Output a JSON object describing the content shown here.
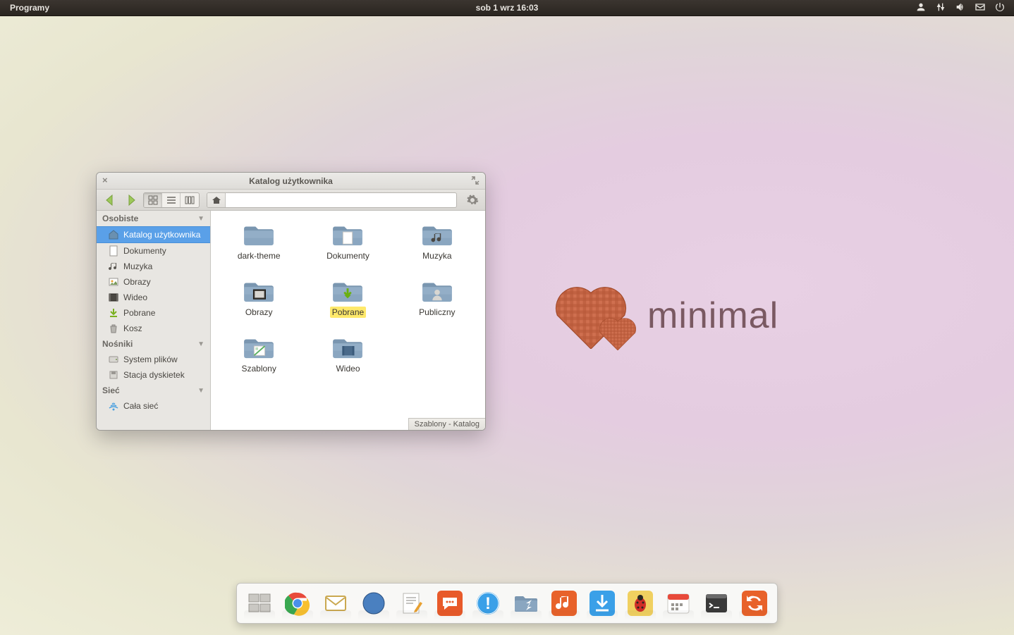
{
  "panel": {
    "menu": "Programy",
    "clock": "sob  1 wrz 16:03"
  },
  "wallpaper": {
    "brand": "minimal"
  },
  "window": {
    "title": "Katalog użytkownika",
    "statusbar": "Szablony - Katalog",
    "sidebar": {
      "sections": [
        {
          "label": "Osobiste",
          "items": [
            {
              "label": "Katalog użytkownika",
              "icon": "home",
              "selected": true
            },
            {
              "label": "Dokumenty",
              "icon": "doc"
            },
            {
              "label": "Muzyka",
              "icon": "music"
            },
            {
              "label": "Obrazy",
              "icon": "image"
            },
            {
              "label": "Wideo",
              "icon": "video"
            },
            {
              "label": "Pobrane",
              "icon": "download"
            },
            {
              "label": "Kosz",
              "icon": "trash"
            }
          ]
        },
        {
          "label": "Nośniki",
          "items": [
            {
              "label": "System plików",
              "icon": "disk"
            },
            {
              "label": "Stacja dyskietek",
              "icon": "floppy"
            }
          ]
        },
        {
          "label": "Sieć",
          "items": [
            {
              "label": "Cała sieć",
              "icon": "network"
            }
          ]
        }
      ]
    },
    "files": [
      {
        "label": "dark-theme",
        "icon": "folder"
      },
      {
        "label": "Dokumenty",
        "icon": "folder-doc"
      },
      {
        "label": "Muzyka",
        "icon": "folder-music"
      },
      {
        "label": "Obrazy",
        "icon": "folder-image"
      },
      {
        "label": "Pobrane",
        "icon": "folder-download",
        "highlight": true
      },
      {
        "label": "Publiczny",
        "icon": "folder-public"
      },
      {
        "label": "Szablony",
        "icon": "folder-template"
      },
      {
        "label": "Wideo",
        "icon": "folder-video"
      }
    ]
  },
  "dock": [
    {
      "name": "workspace-switcher",
      "bg": "#f0eeea"
    },
    {
      "name": "chrome",
      "bg": "#ffffff"
    },
    {
      "name": "mail",
      "bg": "#f9d66a"
    },
    {
      "name": "browser",
      "bg": "#ffffff"
    },
    {
      "name": "text-editor",
      "bg": "#ffffff"
    },
    {
      "name": "chat",
      "bg": "#e85a2a"
    },
    {
      "name": "help",
      "bg": "#3aa0e8"
    },
    {
      "name": "file-manager",
      "bg": "#7a96b0"
    },
    {
      "name": "music-player",
      "bg": "#e8622a"
    },
    {
      "name": "downloader",
      "bg": "#3aa0e8"
    },
    {
      "name": "bug",
      "bg": "#f0d060"
    },
    {
      "name": "calendar",
      "bg": "#ffffff"
    },
    {
      "name": "terminal",
      "bg": "#3a3a3a"
    },
    {
      "name": "update",
      "bg": "#e8622a"
    }
  ]
}
